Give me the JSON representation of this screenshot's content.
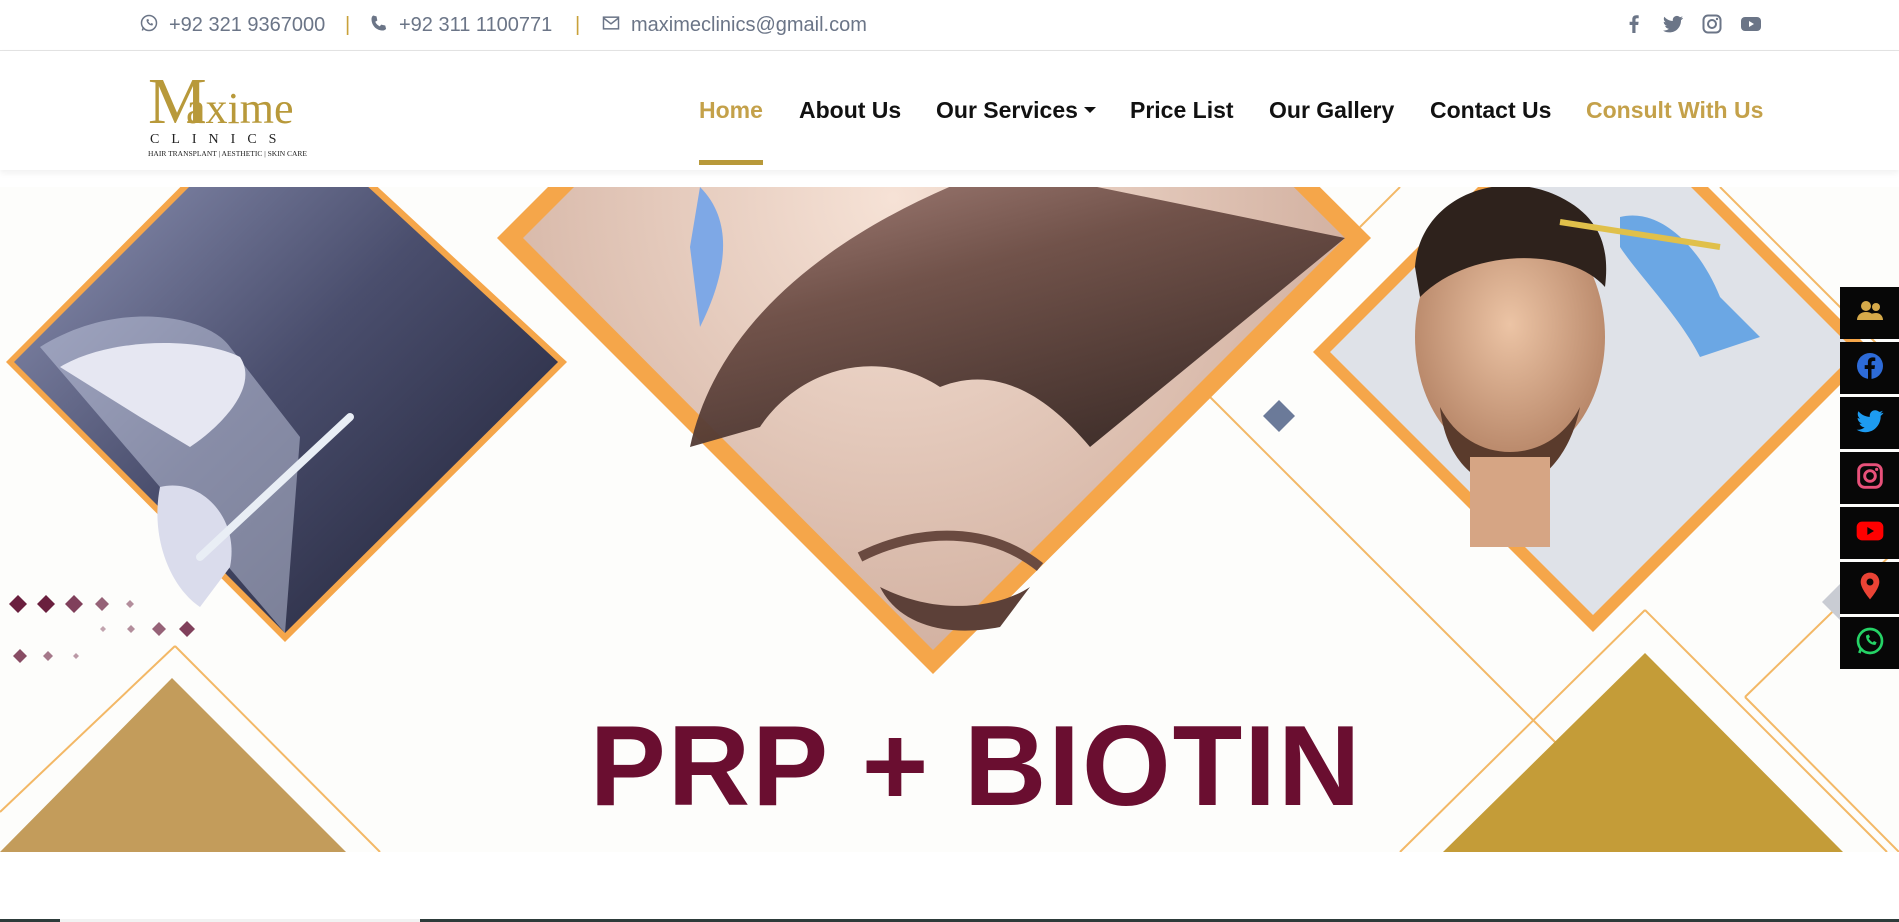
{
  "topbar": {
    "whatsapp": "+92 321 9367000",
    "separator": "|",
    "phone": "+92 311 1100771",
    "email": "maximeclinics@gmail.com",
    "social_icons": [
      "facebook-icon",
      "twitter-icon",
      "instagram-icon",
      "youtube-icon"
    ]
  },
  "logo": {
    "letter": "M",
    "word": "axime",
    "sub": "CLINICS",
    "tagline": "HAIR TRANSPLANT | AESTHETIC | SKIN CARE"
  },
  "nav": {
    "home": "Home",
    "about": "About Us",
    "services": "Our Services",
    "price": "Price List",
    "gallery": "Our Gallery",
    "contact": "Contact Us",
    "consult": "Consult With Us"
  },
  "hero": {
    "title": "PRP + BIOTIN"
  },
  "side_social": [
    "group-icon",
    "facebook-icon",
    "twitter-icon",
    "instagram-icon",
    "youtube-icon",
    "map-pin-icon",
    "whatsapp-icon"
  ],
  "colors": {
    "gold": "#c4a14a",
    "maroon": "#6a0e30",
    "orange_frame": "#f5a64a"
  }
}
